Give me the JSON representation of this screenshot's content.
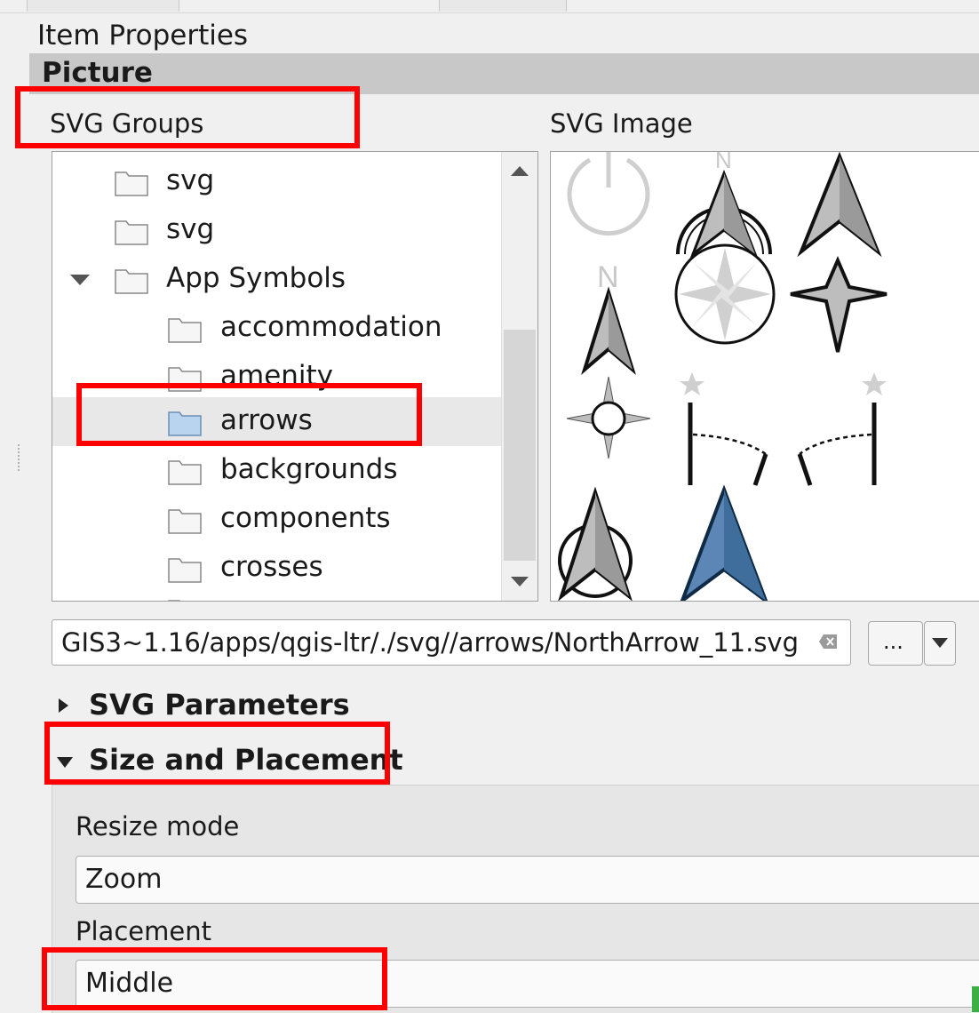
{
  "panel": {
    "title": "Item Properties",
    "section": "Picture"
  },
  "svg_groups": {
    "label": "SVG Groups",
    "items": [
      {
        "label": "svg",
        "level": 0,
        "expanded": false,
        "selected": false
      },
      {
        "label": "svg",
        "level": 0,
        "expanded": false,
        "selected": false
      },
      {
        "label": "App Symbols",
        "level": 0,
        "expanded": true,
        "selected": false
      },
      {
        "label": "accommodation",
        "level": 1,
        "expanded": false,
        "selected": false
      },
      {
        "label": "amenity",
        "level": 1,
        "expanded": false,
        "selected": false
      },
      {
        "label": "arrows",
        "level": 1,
        "expanded": false,
        "selected": true
      },
      {
        "label": "backgrounds",
        "level": 1,
        "expanded": false,
        "selected": false
      },
      {
        "label": "components",
        "level": 1,
        "expanded": false,
        "selected": false
      },
      {
        "label": "crosses",
        "level": 1,
        "expanded": false,
        "selected": false
      }
    ]
  },
  "svg_image": {
    "label": "SVG Image",
    "thumbnails": [
      "power-icon",
      "north-arrow-circle-icon",
      "north-arrow-icon",
      "north-arrow-n-icon",
      "compass-rose-icon",
      "four-point-star-icon",
      "small-compass-icon",
      "star-bracket-left-icon",
      "star-bracket-right-icon",
      "north-arrow-ring-icon",
      "north-arrow-blue-icon"
    ]
  },
  "path": {
    "value": "GIS3~1.16/apps/qgis-ltr/./svg//arrows/NorthArrow_11.svg",
    "browse_label": "..."
  },
  "svg_parameters": {
    "label": "SVG Parameters",
    "expanded": false
  },
  "size_placement": {
    "label": "Size and Placement",
    "expanded": true,
    "resize_mode_label": "Resize mode",
    "resize_mode_value": "Zoom",
    "placement_label": "Placement",
    "placement_value": "Middle"
  },
  "colors": {
    "highlight": "#ff0000",
    "selected_folder": "#b8d4ee",
    "blue_arrow": "#5b86b5"
  }
}
